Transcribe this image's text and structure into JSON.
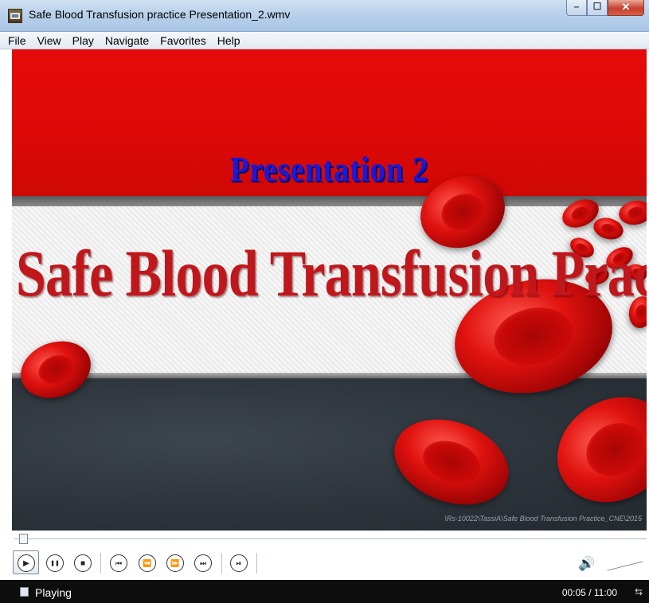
{
  "window": {
    "title": "Safe Blood Transfusion practice Presentation_2.wmv",
    "controls": {
      "minimize": "–",
      "maximize": "☐",
      "close": "✕"
    }
  },
  "menu": [
    "File",
    "View",
    "Play",
    "Navigate",
    "Favorites",
    "Help"
  ],
  "video": {
    "presentation_label": "Presentation 2",
    "slide_title": "Safe Blood Transfusion Practice",
    "watermark": "\\Rs-10022\\TassiA\\Safe  Blood Transfusion Practice_CNE\\2015"
  },
  "transport": {
    "buttons": [
      {
        "name": "play",
        "icon": "play-icon",
        "glyph": "▶"
      },
      {
        "name": "pause",
        "icon": "pause-icon",
        "glyph": "❚❚"
      },
      {
        "name": "stop",
        "icon": "stop-icon",
        "glyph": "■"
      },
      {
        "name": "previous",
        "icon": "previous-icon",
        "glyph": "⏮"
      },
      {
        "name": "rewind",
        "icon": "rewind-icon",
        "glyph": "⏪"
      },
      {
        "name": "fast-forward",
        "icon": "fast-forward-icon",
        "glyph": "⏩"
      },
      {
        "name": "next",
        "icon": "next-icon",
        "glyph": "⏭"
      },
      {
        "name": "frame-step",
        "icon": "frame-step-icon",
        "glyph": "⏯"
      }
    ],
    "volume_icon": "🔊"
  },
  "status": {
    "state": "Playing",
    "time": "00:05 / 11:00",
    "switch_icon": "⇆"
  },
  "colors": {
    "slide_red": "#e50b0a",
    "presentation_label": "#1a19d6",
    "slide_title": "#c0171c"
  }
}
